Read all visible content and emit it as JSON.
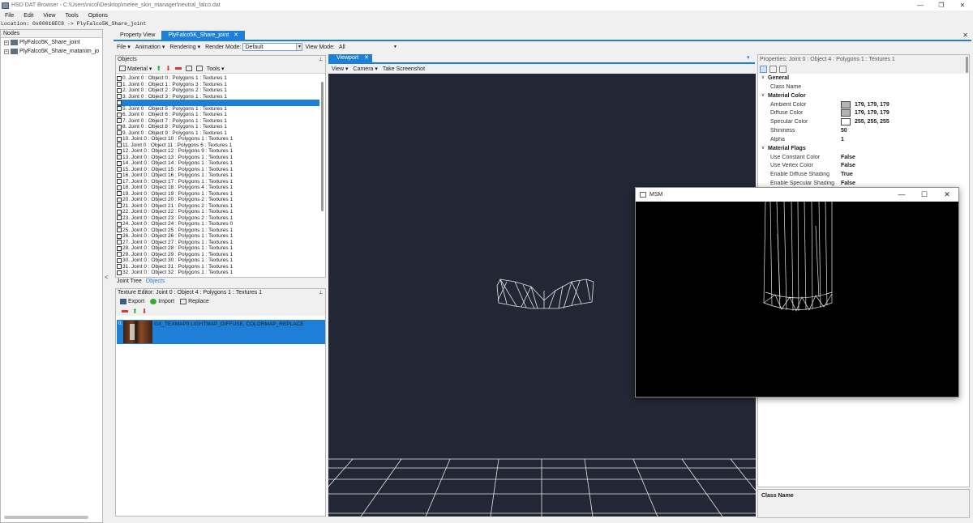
{
  "window": {
    "title": "HSD DAT Browser - C:\\Users\\nicol\\Desktop\\melee_skin_manager\\neutral_falco.dat",
    "min": "—",
    "max": "❐",
    "close": "✕"
  },
  "menu": [
    "File",
    "Edit",
    "View",
    "Tools",
    "Options"
  ],
  "location": "Location: 0x00016EC8 -> PlyFalco5K_Share_joint",
  "nodes": {
    "header": "Nodes",
    "items": [
      {
        "toggle": "+",
        "label": "PlyFalco5K_Share_joint"
      },
      {
        "toggle": "+",
        "label": "PlyFalco5K_Share_matanim_jo"
      }
    ]
  },
  "splitter_arrow": "<",
  "doc_tabs": [
    {
      "label": "Property View"
    },
    {
      "label": "PlyFalco5K_Share_joint",
      "close": "✕"
    }
  ],
  "docs_close": "✕",
  "editor_toolbar": {
    "file": "File ▾",
    "animation": "Animation ▾",
    "rendering": "Rendering ▾",
    "render_mode_label": "Render Mode:",
    "render_mode_value": "Default",
    "view_mode_label": "View Mode:",
    "view_mode_value": "All"
  },
  "objects_panel": {
    "title": "Objects",
    "pin": "⊥",
    "material": "Material ▾",
    "tools": "Tools ▾",
    "items": [
      "0. Joint 0 : Object 0 : Polygons 1 : Textures 1",
      "1. Joint 0 : Object 1 : Polygons 3 : Textures 1",
      "2. Joint 0 : Object 2 : Polygons 2 : Textures 1",
      "3. Joint 0 : Object 3 : Polygons 1 : Textures 1",
      "4. Joint 0 : Object 4 : Polygons 1 : Textures 1",
      "5. Joint 0 : Object 5 : Polygons 1 : Textures 1",
      "6. Joint 0 : Object 6 : Polygons 1 : Textures 1",
      "7. Joint 0 : Object 7 : Polygons 1 : Textures 1",
      "8. Joint 0 : Object 8 : Polygons 1 : Textures 1",
      "9. Joint 0 : Object 9 : Polygons 1 : Textures 1",
      "10. Joint 0 : Object 10 : Polygons 1 : Textures 1",
      "11. Joint 0 : Object 11 : Polygons 6 : Textures 1",
      "12. Joint 0 : Object 12 : Polygons 9 : Textures 1",
      "13. Joint 0 : Object 13 : Polygons 1 : Textures 1",
      "14. Joint 0 : Object 14 : Polygons 1 : Textures 1",
      "15. Joint 0 : Object 15 : Polygons 1 : Textures 1",
      "16. Joint 0 : Object 16 : Polygons 1 : Textures 1",
      "17. Joint 0 : Object 17 : Polygons 1 : Textures 1",
      "18. Joint 0 : Object 18 : Polygons 4 : Textures 1",
      "19. Joint 0 : Object 19 : Polygons 1 : Textures 1",
      "20. Joint 0 : Object 20 : Polygons 2 : Textures 1",
      "21. Joint 0 : Object 21 : Polygons 2 : Textures 1",
      "22. Joint 0 : Object 22 : Polygons 1 : Textures 1",
      "23. Joint 0 : Object 23 : Polygons 2 : Textures 1",
      "24. Joint 0 : Object 24 : Polygons 1 : Textures 0",
      "25. Joint 0 : Object 25 : Polygons 1 : Textures 1",
      "26. Joint 0 : Object 26 : Polygons 1 : Textures 1",
      "27. Joint 0 : Object 27 : Polygons 1 : Textures 1",
      "28. Joint 0 : Object 28 : Polygons 1 : Textures 1",
      "29. Joint 0 : Object 29 : Polygons 1 : Textures 1",
      "30. Joint 0 : Object 30 : Polygons 1 : Textures 1",
      "31. Joint 0 : Object 31 : Polygons 1 : Textures 1",
      "32. Joint 0 : Object 32 : Polygons 1 : Textures 1"
    ],
    "selected_index": 4
  },
  "left_tabs": [
    "Joint Tree",
    "Objects"
  ],
  "texture_editor": {
    "title": "Texture Editor: Joint 0 : Object 4 : Polygons 1 : Textures 1",
    "pin": "⊥",
    "export": "Export",
    "import": "Import",
    "replace": "Replace",
    "item_index": "0.",
    "item_label": "GX_TEXMAP0 LIGHTMAP_DIFFUSE, COLORMAP_REPLACE"
  },
  "viewport": {
    "tab": "Viewport",
    "close": "✕",
    "dropdown": "▾",
    "menu": [
      "View ▾",
      "Camera ▾",
      "Take Screenshot"
    ]
  },
  "properties": {
    "title": "Properties: Joint 0 : Object 4 : Polygons 1 : Textures 1",
    "pin": "⊥",
    "categories": [
      {
        "name": "General",
        "rows": [
          {
            "name": "Class Name",
            "value": ""
          }
        ]
      },
      {
        "name": "Material Color",
        "rows": [
          {
            "name": "Ambient Color",
            "value": "179, 179, 179",
            "color": "#b3b3b3"
          },
          {
            "name": "Diffuse Color",
            "value": "179, 179, 179",
            "color": "#b3b3b3"
          },
          {
            "name": "Specular Color",
            "value": "255, 255, 255",
            "color": "#ffffff"
          },
          {
            "name": "Shininess",
            "value": "50"
          },
          {
            "name": "Alpha",
            "value": "1"
          }
        ]
      },
      {
        "name": "Material Flags",
        "rows": [
          {
            "name": "Use Constant Color",
            "value": "False"
          },
          {
            "name": "Use Vertex Color",
            "value": "False"
          },
          {
            "name": "Enable Diffuse Shading",
            "value": "True"
          },
          {
            "name": "Enable Specular Shading",
            "value": "False"
          }
        ]
      }
    ],
    "description_title": "Class Name"
  },
  "msm_window": {
    "title": "MSM",
    "min": "—",
    "max": "☐",
    "close": "✕"
  },
  "colors": {
    "accent": "#1e7fd8",
    "viewport_bg": "#232634",
    "selection": "#1e7fd8"
  }
}
